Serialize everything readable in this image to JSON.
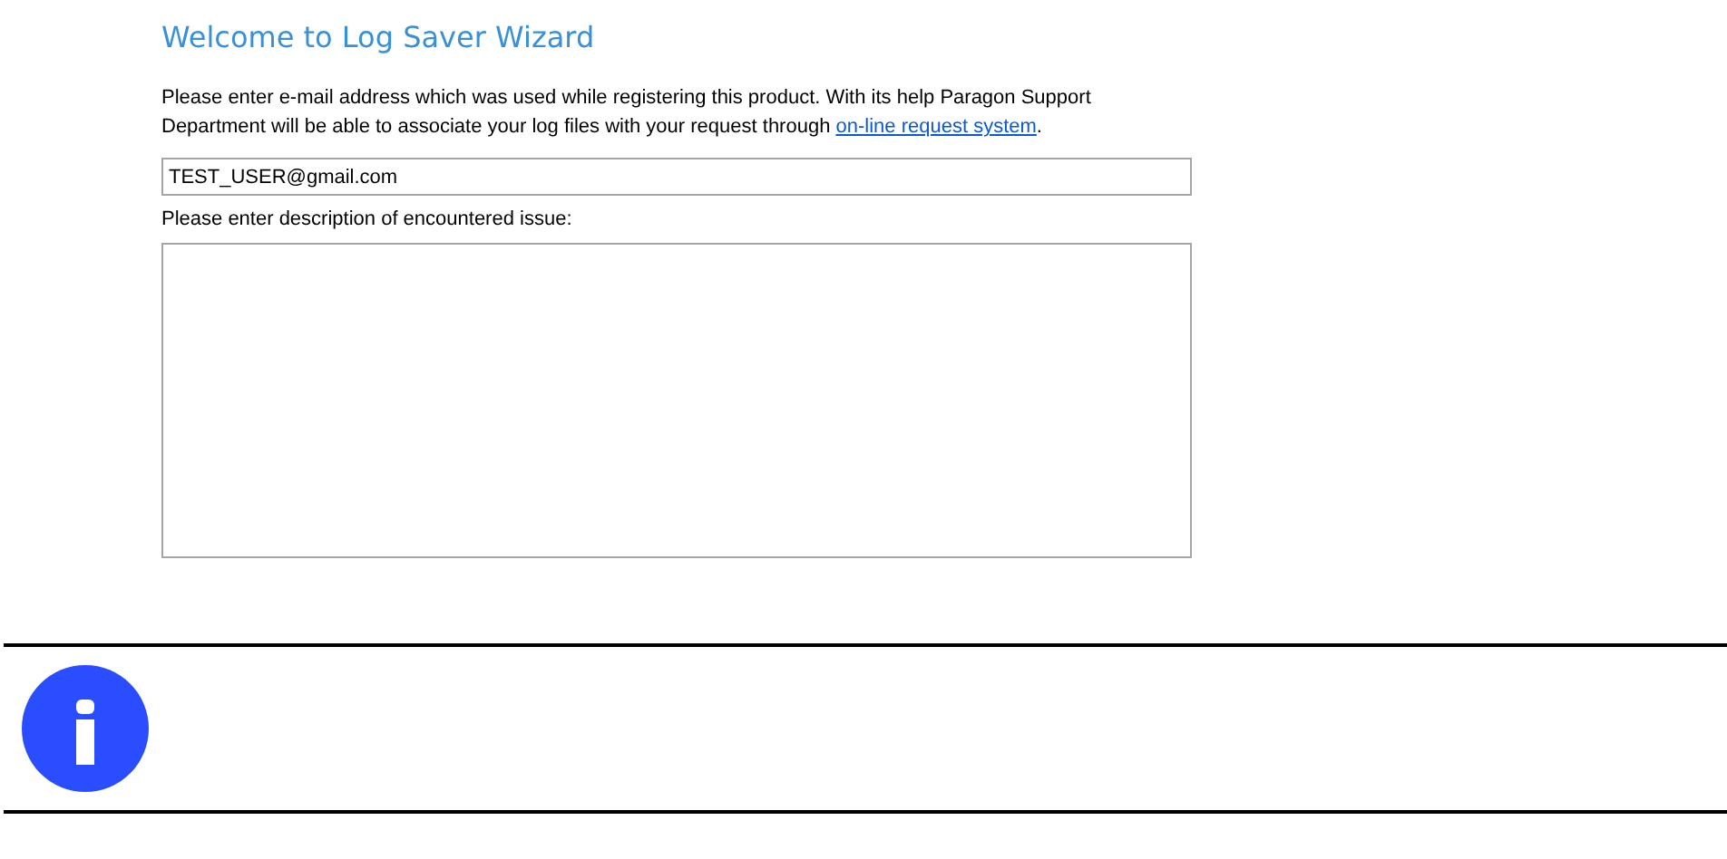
{
  "title": "Welcome to Log Saver Wizard",
  "intro": {
    "text": "Please enter e-mail address which was used while registering this product. With its help Paragon Support Department will be able to associate your log files with your request through ",
    "link": "on-line request system",
    "tail": "."
  },
  "email": {
    "value": "TEST_USER@gmail.com"
  },
  "description": {
    "label": "Please enter description of encountered issue:"
  },
  "note": {
    "kind": "info"
  }
}
